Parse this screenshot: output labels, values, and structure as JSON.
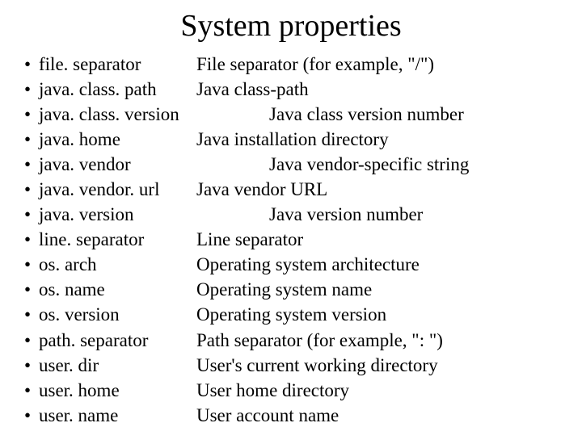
{
  "title": "System properties",
  "items": [
    {
      "col": "a",
      "prop": "file. separator",
      "desc": "File separator (for example, \"/\")"
    },
    {
      "col": "a",
      "prop": "java. class. path",
      "desc": "Java class-path"
    },
    {
      "col": "b",
      "prop": "java. class. version",
      "desc": "Java class version number"
    },
    {
      "col": "a",
      "prop": "java. home",
      "desc": "Java installation directory"
    },
    {
      "col": "b",
      "prop": "java. vendor",
      "desc": "Java vendor-specific string"
    },
    {
      "col": "a",
      "prop": "java. vendor. url",
      "desc": "Java vendor URL"
    },
    {
      "col": "b",
      "prop": "java. version",
      "desc": "Java version number"
    },
    {
      "col": "a",
      "prop": "line. separator",
      "desc": "Line separator"
    },
    {
      "col": "a",
      "prop": "os. arch",
      "desc": "Operating system architecture"
    },
    {
      "col": "a",
      "prop": "os. name",
      "desc": "Operating system name"
    },
    {
      "col": "a",
      "prop": "os. version",
      "desc": "Operating system version"
    },
    {
      "col": "a",
      "prop": "path. separator",
      "desc": "Path separator (for example, \": \")"
    },
    {
      "col": "a",
      "prop": "user. dir",
      "desc": "User's current working directory"
    },
    {
      "col": "a",
      "prop": "user. home",
      "desc": "User home directory"
    },
    {
      "col": "a",
      "prop": "user. name",
      "desc": "User account name"
    }
  ]
}
